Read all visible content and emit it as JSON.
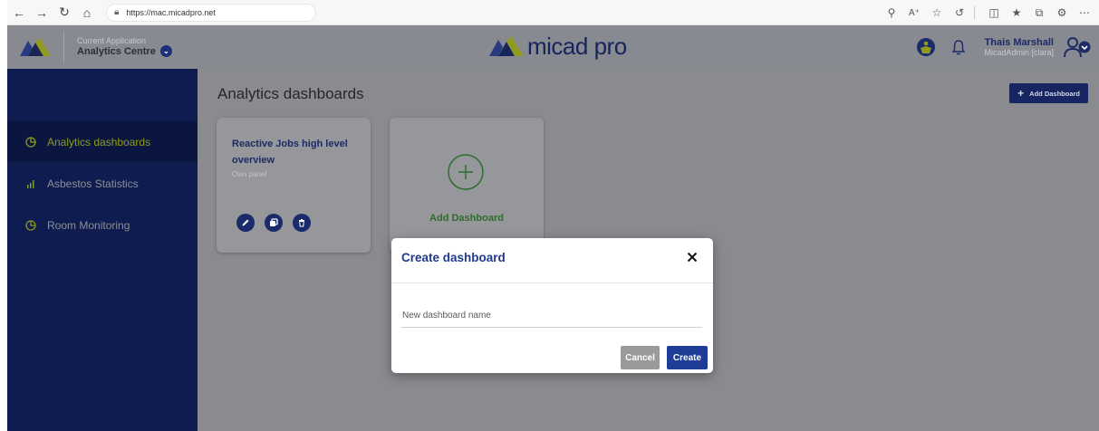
{
  "browser": {
    "url": "https://mac.micadpro.net",
    "icons": [
      "back-icon",
      "forward-icon",
      "reload-icon",
      "home-icon",
      "lock-icon",
      "zoom-icon",
      "read-aloud-icon",
      "favorite-icon",
      "refresh-icon",
      "split-screen-icon",
      "favorites-icon",
      "collections-icon",
      "extensions-icon",
      "more-icon"
    ]
  },
  "header": {
    "app_caption": "Current Application",
    "app_name": "Analytics Centre",
    "brand": "micad pro",
    "user_name": "Thais Marshall",
    "user_role": "MicadAdmin [clara]"
  },
  "sidebar": {
    "items": [
      {
        "label": "Analytics dashboards",
        "icon": "pie-chart-icon",
        "active": true
      },
      {
        "label": "Asbestos Statistics",
        "icon": "bar-chart-icon",
        "active": false
      },
      {
        "label": "Room Monitoring",
        "icon": "pie-chart-icon",
        "active": false
      }
    ]
  },
  "main": {
    "title": "Analytics dashboards",
    "add_button": "Add Dashboard",
    "cards": [
      {
        "title": "Reactive Jobs high level overview",
        "subtitle": "Own panel",
        "actions": [
          "edit-icon",
          "copy-icon",
          "delete-icon"
        ]
      },
      {
        "title": "Add Dashboard",
        "icon": "add-circle-icon"
      }
    ]
  },
  "modal": {
    "title": "Create dashboard",
    "input_placeholder": "New dashboard name",
    "input_value": "",
    "cancel_label": "Cancel",
    "create_label": "Create"
  },
  "colors": {
    "brand_navy": "#0e1c4f",
    "accent_olive": "#8f9a1e",
    "overlay_gray": "#8a8b8f",
    "primary_button": "#1d3d96",
    "add_green": "#2e6c2f"
  }
}
